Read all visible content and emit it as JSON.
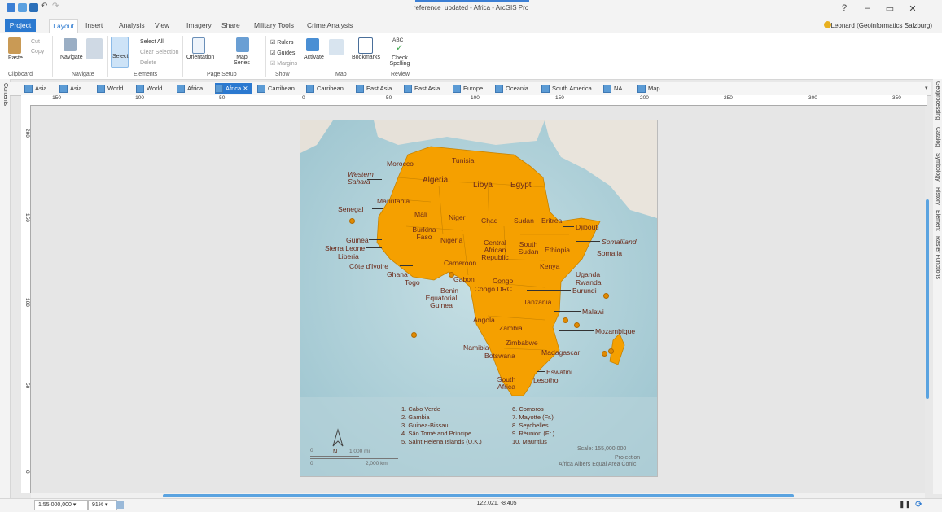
{
  "window": {
    "title": "reference_updated - Africa - ArcGIS Pro",
    "help": "?"
  },
  "ribbon_tabs": [
    "Project",
    "Layout",
    "Insert",
    "Analysis",
    "View",
    "Imagery",
    "Share",
    "Military Tools",
    "Crime Analysis"
  ],
  "user": "Leonard (Geoinformatics Salzburg)",
  "ribbon": {
    "clipboard": {
      "group": "Clipboard",
      "paste": "Paste",
      "cut": "Cut",
      "copy": "Copy"
    },
    "navigate": {
      "group": "Navigate",
      "navigate": "Navigate"
    },
    "elements": {
      "group": "Elements",
      "select": "Select",
      "select_all": "Select All",
      "clear_selection": "Clear Selection",
      "delete": "Delete"
    },
    "page_setup": {
      "group": "Page Setup",
      "orientation": "Orientation",
      "map_series": "Map Series"
    },
    "show": {
      "group": "Show",
      "rulers": "Rulers",
      "guides": "Guides",
      "margins": "Margins"
    },
    "map": {
      "group": "Map",
      "activate": "Activate",
      "bookmarks": "Bookmarks"
    },
    "review": {
      "group": "Review",
      "spelling": "Check Spelling",
      "abc": "ABC"
    }
  },
  "view_tabs": [
    {
      "label": "Asia",
      "active": false
    },
    {
      "label": "Asia",
      "active": false
    },
    {
      "label": "World",
      "active": false
    },
    {
      "label": "World",
      "active": false
    },
    {
      "label": "Africa",
      "active": false
    },
    {
      "label": "Africa",
      "active": true
    },
    {
      "label": "Carribean",
      "active": false
    },
    {
      "label": "Carribean",
      "active": false
    },
    {
      "label": "East Asia",
      "active": false
    },
    {
      "label": "East Asia",
      "active": false
    },
    {
      "label": "Europe",
      "active": false
    },
    {
      "label": "Oceania",
      "active": false
    },
    {
      "label": "South America",
      "active": false
    },
    {
      "label": "NA",
      "active": false
    },
    {
      "label": "Map",
      "active": false
    }
  ],
  "left_rail": "Contents",
  "right_rail": [
    "Geoprocessing",
    "Catalog",
    "Symbology",
    "History",
    "Element",
    "Raster Functions"
  ],
  "ruler_labels": [
    "-150",
    "-100",
    "-50",
    "0",
    "50",
    "100",
    "150",
    "200",
    "250",
    "300",
    "350"
  ],
  "vruler_labels": [
    "200",
    "150",
    "100",
    "50",
    "0"
  ],
  "map": {
    "countries": [
      "Morocco",
      "Tunisia",
      "Western Sahara",
      "Algeria",
      "Libya",
      "Egypt",
      "Mauritania",
      "Senegal",
      "Mali",
      "Niger",
      "Chad",
      "Sudan",
      "Eritrea",
      "Djibouti",
      "Burkina Faso",
      "Guinea",
      "Sierra Leone",
      "Liberia",
      "Côte d'Ivoire",
      "Ghana",
      "Togo",
      "Benin",
      "Nigeria",
      "Central African Republic",
      "South Sudan",
      "Ethiopia",
      "Somaliland",
      "Somalia",
      "Cameroon",
      "Kenya",
      "Gabon",
      "Congo",
      "Congo DRC",
      "Uganda",
      "Rwanda",
      "Burundi",
      "Equatorial Guinea",
      "Tanzania",
      "Malawi",
      "Angola",
      "Zambia",
      "Mozambique",
      "Namibia",
      "Zimbabwe",
      "Botswana",
      "Madagascar",
      "Eswatini",
      "South Africa",
      "Lesotho"
    ],
    "legend": [
      "1. Cabo Verde",
      "2. Gambia",
      "3. Guinea-Bissau",
      "4. São Tomé and Príncipe",
      "5. Saint Helena Islands (U.K.)",
      "6. Comoros",
      "7. Mayotte (Fr.)",
      "8. Seychelles",
      "9. Réunion (Fr.)",
      "10. Mauritius"
    ],
    "north": "N",
    "scalebar": {
      "mi": "1,000 mi",
      "km": "2,000 km",
      "zero": "0"
    },
    "scale_text": "Scale: 155,000,000",
    "projection": "Projection",
    "projection_name": "Africa Albers Equal Area Conic",
    "colors": {
      "land": "#f5a000",
      "ocean": "#d8e8ef",
      "label": "#6b2a1a"
    }
  },
  "status": {
    "scale": "1:55,000,000",
    "zoom": "91%",
    "coords": "122.021, -8.405"
  }
}
